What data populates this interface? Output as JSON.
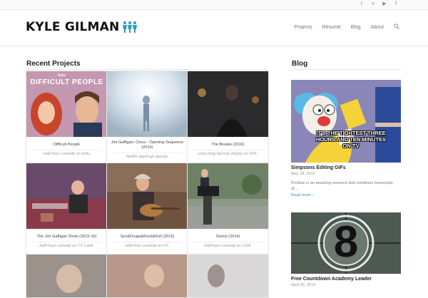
{
  "topbar": {
    "social": [
      {
        "icon": "twitter-icon",
        "glyph": "t"
      },
      {
        "icon": "vimeo-icon",
        "glyph": "v"
      },
      {
        "icon": "youtube-icon",
        "glyph": "▶"
      },
      {
        "icon": "facebook-icon",
        "glyph": "f"
      }
    ]
  },
  "header": {
    "logo": "KYLE GILMAN",
    "nav": [
      "Projects",
      "Résumé",
      "Blog",
      "About"
    ],
    "search_icon": "search-icon"
  },
  "recent_projects": {
    "title": "Recent Projects",
    "items": [
      {
        "title": "Difficult People",
        "subtitle": "Half-hour comedy on Hulu",
        "thumb_text": "hulu ORIGINAL DIFFICULT PEOPLE"
      },
      {
        "title": "Jim Gaffigan: Cinco - Opening Sequence (2016)",
        "subtitle": "Netflix stand-up special.",
        "thumb_text": ""
      },
      {
        "title": "The Breaks (2016)",
        "subtitle": "Hour-long hip-hop drama on VH1.",
        "thumb_text": ""
      },
      {
        "title": "The Jim Gaffigan Show (2015-16)",
        "subtitle": "Half-hour comedy on TV Land.",
        "thumb_text": ""
      },
      {
        "title": "Sex&Drugs&Rock&Roll (2015)",
        "subtitle": "Half-hour comedy on FX.",
        "thumb_text": ""
      },
      {
        "title": "Sirens (2014)",
        "subtitle": "Half-hour comedy on USA.",
        "thumb_text": ""
      }
    ]
  },
  "blog": {
    "title": "Blog",
    "posts": [
      {
        "title": "Simpsons Editing GIFs",
        "date": "May 28, 2016",
        "excerpt": "Frinkiac is an amazing resource that combines transcripts of…",
        "read_more": "Read more",
        "image_caption": "IT'S THE TIGHTEST THREE HOURS AND TEN MINUTES ON TV"
      },
      {
        "title": "Free Countdown Academy Leader",
        "date": "April 26, 2016",
        "image_text": "8"
      }
    ]
  },
  "colors": {
    "accent": "#3b8fd3",
    "logo_figures": "#2a9fc0"
  }
}
